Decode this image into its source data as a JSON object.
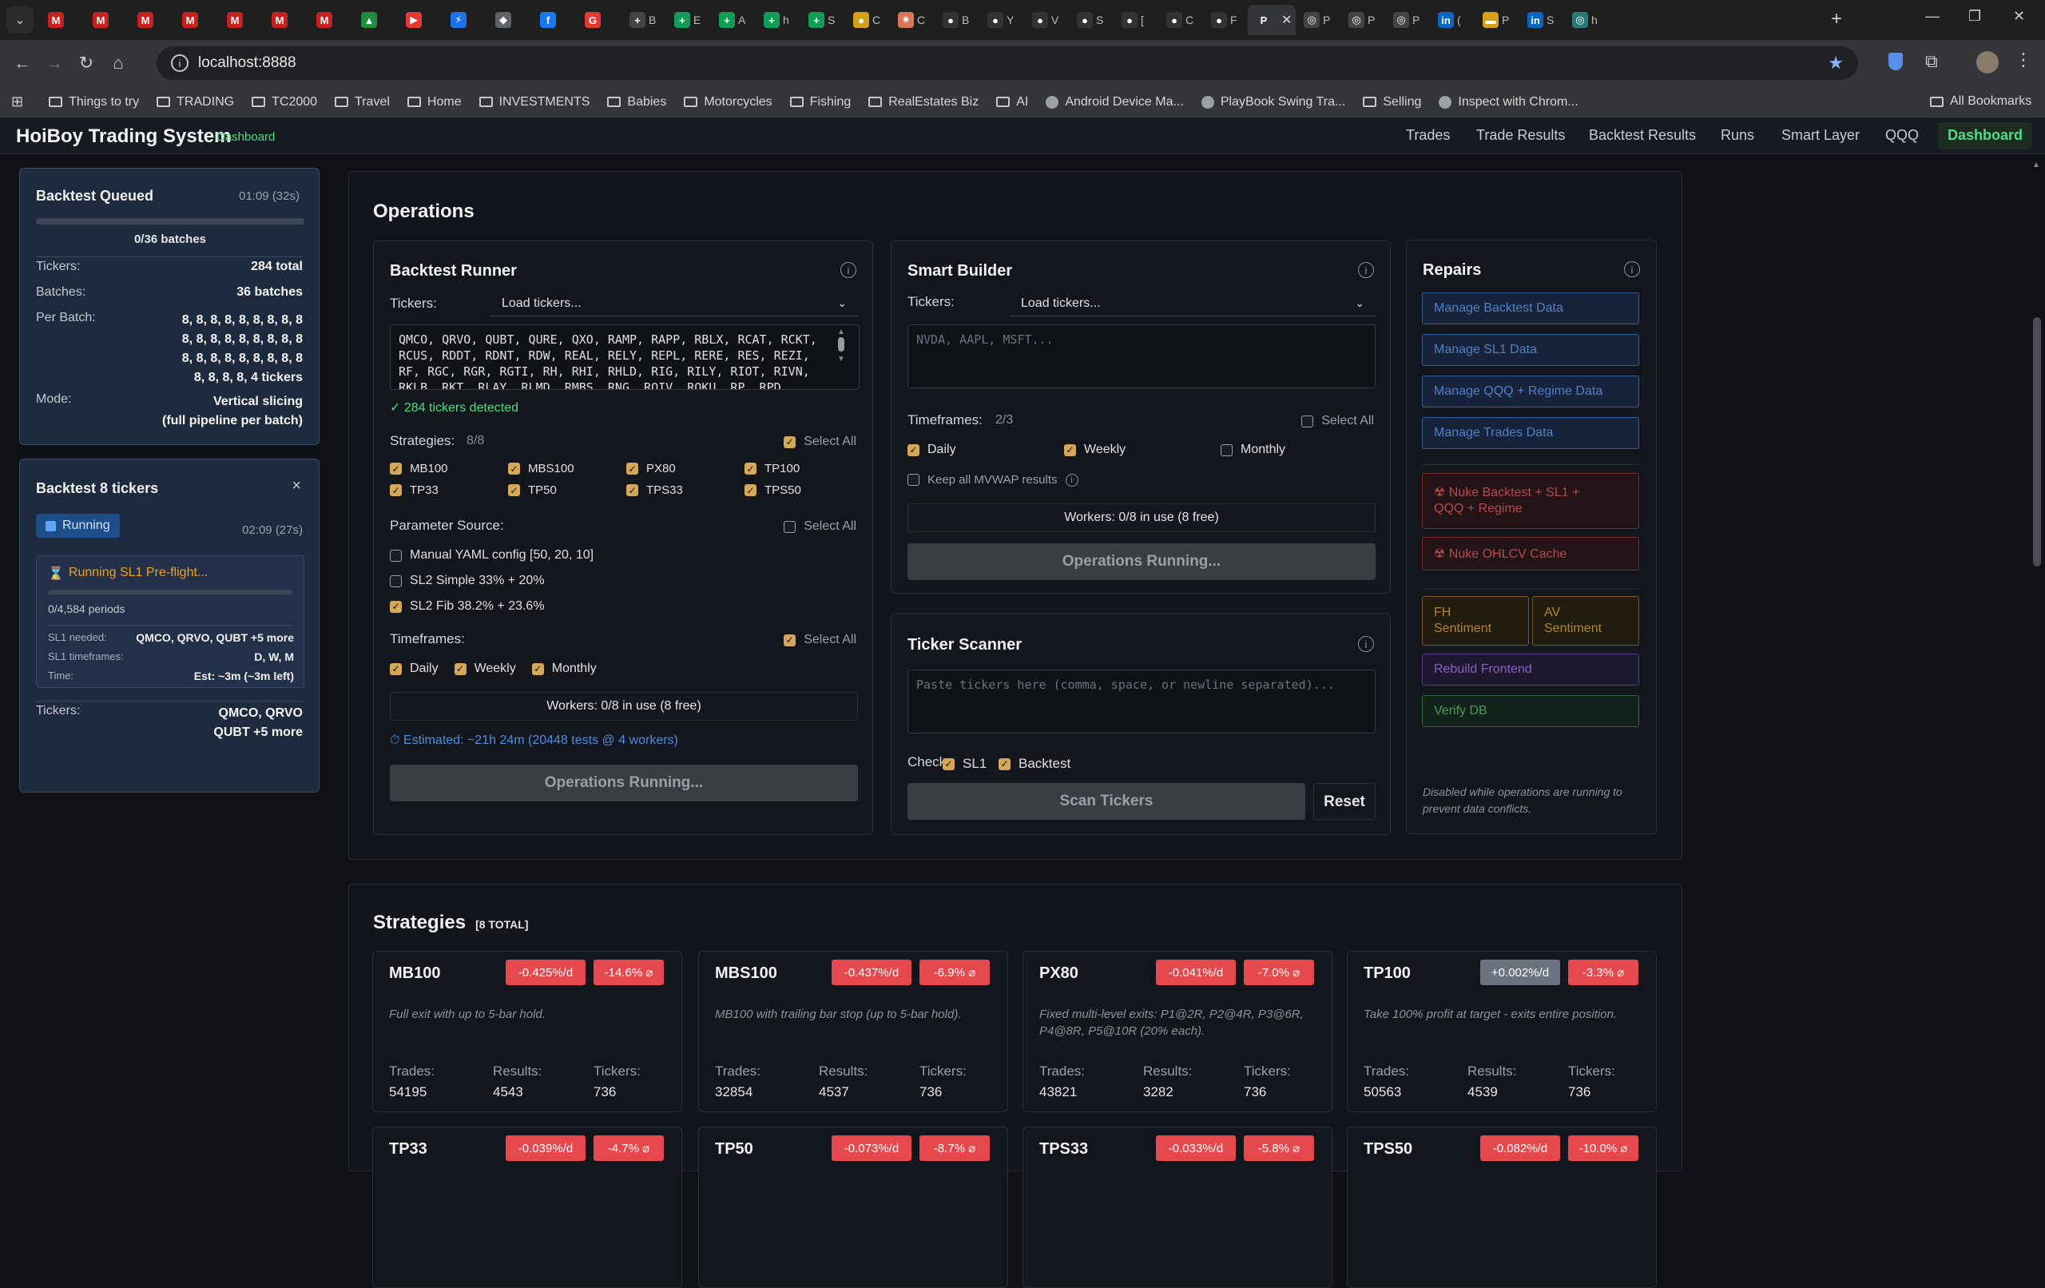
{
  "browser": {
    "tabs": [
      {
        "icon": "M",
        "color": "#c5221f",
        "label": ""
      },
      {
        "icon": "M",
        "color": "#c5221f",
        "label": ""
      },
      {
        "icon": "M",
        "color": "#c5221f",
        "label": ""
      },
      {
        "icon": "M",
        "color": "#c5221f",
        "label": ""
      },
      {
        "icon": "M",
        "color": "#c5221f",
        "label": ""
      },
      {
        "icon": "M",
        "color": "#c5221f",
        "label": ""
      },
      {
        "icon": "M",
        "color": "#c5221f",
        "label": ""
      },
      {
        "icon": "▲",
        "color": "#1e8e3e",
        "label": ""
      },
      {
        "icon": "▶",
        "color": "#e53935",
        "label": ""
      },
      {
        "icon": "⚡",
        "color": "#1a73e8",
        "label": ""
      },
      {
        "icon": "◆",
        "color": "#5f6368",
        "label": ""
      },
      {
        "icon": "f",
        "color": "#1877f2",
        "label": ""
      },
      {
        "icon": "G",
        "color": "#e53935",
        "label": ""
      },
      {
        "icon": "+",
        "color": "#444",
        "label": "B"
      },
      {
        "icon": "+",
        "color": "#0f9d58",
        "label": "E"
      },
      {
        "icon": "+",
        "color": "#0f9d58",
        "label": "A"
      },
      {
        "icon": "+",
        "color": "#0f9d58",
        "label": "h"
      },
      {
        "icon": "+",
        "color": "#0f9d58",
        "label": "S"
      },
      {
        "icon": "●",
        "color": "#d4a017",
        "label": "C"
      },
      {
        "icon": "✷",
        "color": "#d97757",
        "label": "C"
      },
      {
        "icon": "●",
        "color": "#333",
        "label": "B"
      },
      {
        "icon": "●",
        "color": "#333",
        "label": "Y"
      },
      {
        "icon": "●",
        "color": "#333",
        "label": "V"
      },
      {
        "icon": "●",
        "color": "#333",
        "label": "S"
      },
      {
        "icon": "●",
        "color": "#333",
        "label": "["
      },
      {
        "icon": "●",
        "color": "#333",
        "label": "C"
      },
      {
        "icon": "●",
        "color": "#333",
        "label": "F"
      },
      {
        "icon": "P",
        "color": "#35363a",
        "label": ""
      },
      {
        "icon": "◎",
        "color": "#444",
        "label": "P"
      },
      {
        "icon": "◎",
        "color": "#444",
        "label": "P"
      },
      {
        "icon": "◎",
        "color": "#444",
        "label": "P"
      },
      {
        "icon": "in",
        "color": "#0a66c2",
        "label": "("
      },
      {
        "icon": "▬",
        "color": "#d4a017",
        "label": "P"
      },
      {
        "icon": "in",
        "color": "#0a66c2",
        "label": "S"
      },
      {
        "icon": "◎",
        "color": "#2a7a7a",
        "label": "h"
      }
    ],
    "url": "localhost:8888",
    "bookmarks": [
      "Things to try",
      "TRADING",
      "TC2000",
      "Travel",
      "Home",
      "INVESTMENTS",
      "Babies",
      "Motorcycles",
      "Fishing",
      "RealEstates Biz",
      "AI",
      "Android Device Ma...",
      "PlayBook Swing Tra...",
      "Selling",
      "Inspect with Chrom..."
    ],
    "all_bookmarks": "All Bookmarks"
  },
  "header": {
    "brand": "HoiBoy Trading System",
    "sub": "Dashboard",
    "nav": [
      "Trades",
      "Trade Results",
      "Backtest Results",
      "Runs",
      "Smart Layer",
      "QQQ"
    ],
    "active": "Dashboard"
  },
  "queued": {
    "title": "Backtest Queued",
    "time": "01:09 (32s)",
    "batches_progress": "0/36 batches",
    "progress": 0,
    "tickers_k": "Tickers:",
    "tickers_v": "284 total",
    "batches_k": "Batches:",
    "batches_v": "36 batches",
    "perbatch_k": "Per Batch:",
    "perbatch_lines": [
      "8, 8, 8, 8, 8, 8, 8, 8, 8",
      "8, 8, 8, 8, 8, 8, 8, 8, 8",
      "8, 8, 8, 8, 8, 8, 8, 8, 8",
      "8, 8, 8, 8, 4 tickers"
    ],
    "mode_k": "Mode:",
    "mode_lines": [
      "Vertical slicing",
      "(full pipeline per batch)"
    ]
  },
  "running": {
    "title": "Backtest 8 tickers",
    "close": "×",
    "status": "Running",
    "time": "02:09 (27s)",
    "step": "Running SL1 Pre-flight...",
    "periods": "0/4,584 periods",
    "progress": 0,
    "sl1_needed_k": "SL1 needed:",
    "sl1_needed_v": "QMCO, QRVO, QUBT +5 more",
    "sl1_tf_k": "SL1 timeframes:",
    "sl1_tf_v": "D, W, M",
    "time_k": "Time:",
    "time_v": "Est: ~3m (~3m left)",
    "tickers_k": "Tickers:",
    "tickers_lines": [
      "QMCO, QRVO",
      "QUBT +5 more"
    ]
  },
  "operations": {
    "title": "Operations",
    "runner": {
      "title": "Backtest Runner",
      "tickers_label": "Tickers:",
      "load": "Load tickers...",
      "ticker_text": "QMCO, QRVO, QUBT, QURE, QXO, RAMP, RAPP, RBLX, RCAT, RCKT, RCUS, RDDT, RDNT, RDW, REAL, RELY, REPL, RERE, RES, REZI, RF, RGC, RGR, RGTI, RH, RHI, RHLD, RIG, RILY, RIOT, RIVN, RKLB, RKT, RLAY, RLMD, RMBS, RNG, ROIV, ROKU, RP, RPD",
      "detected": "✓ 284 tickers detected",
      "strategies_label": "Strategies:",
      "strategies_count": "8/8",
      "select_all": "Select All",
      "strategies": [
        "MB100",
        "MBS100",
        "PX80",
        "TP100",
        "TP33",
        "TP50",
        "TPS33",
        "TPS50"
      ],
      "param_label": "Parameter Source:",
      "params": [
        {
          "label": "Manual YAML config [50, 20, 10]",
          "checked": false
        },
        {
          "label": "SL2 Simple 33% + 20%",
          "checked": false
        },
        {
          "label": "SL2 Fib 38.2% + 23.6%",
          "checked": true
        }
      ],
      "tf_label": "Timeframes:",
      "timeframes": [
        "Daily",
        "Weekly",
        "Monthly"
      ],
      "workers": "Workers: 0/8 in use (8 free)",
      "estimate": "⏱ Estimated: ~21h 24m (20448 tests @ 4 workers)",
      "button": "Operations Running..."
    },
    "smart": {
      "title": "Smart Builder",
      "tickers_label": "Tickers:",
      "load": "Load tickers...",
      "placeholder": "NVDA, AAPL, MSFT...",
      "tf_label": "Timeframes:",
      "tf_count": "2/3",
      "select_all": "Select All",
      "timeframes": [
        {
          "label": "Daily",
          "checked": true
        },
        {
          "label": "Weekly",
          "checked": true
        },
        {
          "label": "Monthly",
          "checked": false
        }
      ],
      "keep_mvwap": "Keep all MVWAP results",
      "workers": "Workers: 0/8 in use (8 free)",
      "button": "Operations Running..."
    },
    "scanner": {
      "title": "Ticker Scanner",
      "placeholder": "Paste tickers here (comma, space, or newline separated)...",
      "check_label": "Check:",
      "checks": [
        "SL1",
        "Backtest"
      ],
      "scan": "Scan Tickers",
      "reset": "Reset"
    },
    "repairs": {
      "title": "Repairs",
      "blue": [
        "Manage Backtest Data",
        "Manage SL1 Data",
        "Manage QQQ + Regime Data",
        "Manage Trades Data"
      ],
      "nuke1": "☢ Nuke Backtest + SL1 + QQQ + Regime",
      "nuke2": "☢ Nuke OHLCV Cache",
      "fh": "FH Sentiment",
      "av": "AV Sentiment",
      "rebuild": "Rebuild Frontend",
      "verify": "Verify DB",
      "note": "Disabled while operations are running to prevent data conflicts."
    }
  },
  "strategies": {
    "title": "Strategies",
    "total": "[8 TOTAL]",
    "stat_labels": [
      "Trades:",
      "Results:",
      "Tickers:"
    ],
    "cards": [
      {
        "name": "MB100",
        "rate": "-0.425%/d",
        "avg": "-14.6% ⌀",
        "rate_color": "#e5484d",
        "desc": "Full exit with up to 5-bar hold.",
        "trades": "54195",
        "results": "4543",
        "tickers": "736"
      },
      {
        "name": "MBS100",
        "rate": "-0.437%/d",
        "avg": "-6.9% ⌀",
        "rate_color": "#e5484d",
        "desc": "MB100 with trailing bar stop (up to 5-bar hold).",
        "trades": "32854",
        "results": "4537",
        "tickers": "736"
      },
      {
        "name": "PX80",
        "rate": "-0.041%/d",
        "avg": "-7.0% ⌀",
        "rate_color": "#e5484d",
        "desc": "Fixed multi-level exits: P1@2R, P2@4R, P3@6R, P4@8R, P5@10R (20% each).",
        "trades": "43821",
        "results": "3282",
        "tickers": "736"
      },
      {
        "name": "TP100",
        "rate": "+0.002%/d",
        "avg": "-3.3% ⌀",
        "rate_color": "#6b7280",
        "desc": "Take 100% profit at target - exits entire position.",
        "trades": "50563",
        "results": "4539",
        "tickers": "736"
      },
      {
        "name": "TP33",
        "rate": "-0.039%/d",
        "avg": "-4.7% ⌀",
        "rate_color": "#e5484d",
        "desc": "",
        "trades": "",
        "results": "",
        "tickers": ""
      },
      {
        "name": "TP50",
        "rate": "-0.073%/d",
        "avg": "-8.7% ⌀",
        "rate_color": "#e5484d",
        "desc": "",
        "trades": "",
        "results": "",
        "tickers": ""
      },
      {
        "name": "TPS33",
        "rate": "-0.033%/d",
        "avg": "-5.8% ⌀",
        "rate_color": "#e5484d",
        "desc": "",
        "trades": "",
        "results": "",
        "tickers": ""
      },
      {
        "name": "TPS50",
        "rate": "-0.082%/d",
        "avg": "-10.0% ⌀",
        "rate_color": "#e5484d",
        "desc": "",
        "trades": "",
        "results": "",
        "tickers": ""
      }
    ]
  }
}
